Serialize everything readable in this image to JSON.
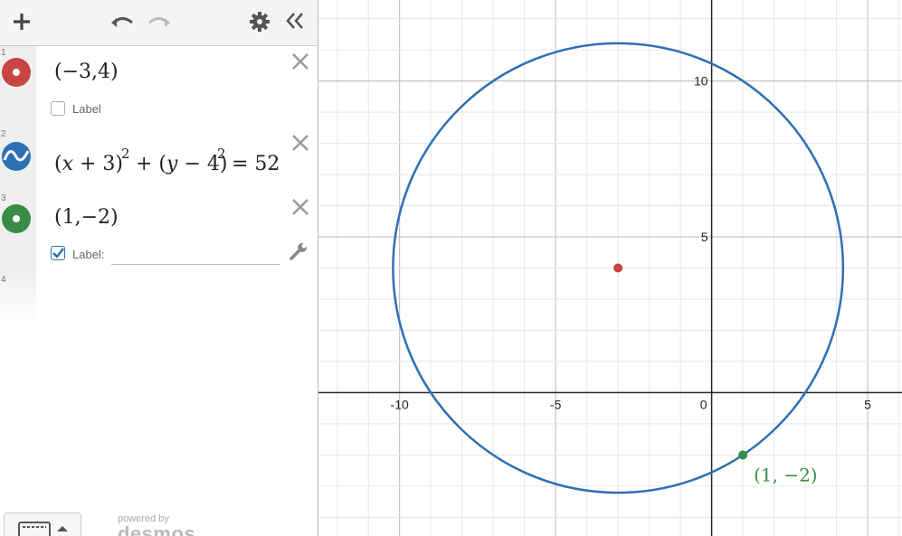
{
  "toolbar": {
    "add_icon": "plus-icon",
    "undo_icon": "undo-icon",
    "redo_icon": "redo-icon",
    "settings_icon": "gear-icon",
    "collapse_icon": "double-chevron-left-icon"
  },
  "expressions": [
    {
      "number": "1",
      "latex": "(−3,4)",
      "color": "#c74440",
      "type": "point",
      "label_text": "Label",
      "label_checked": false
    },
    {
      "number": "2",
      "latex": "(x+3)^2+(y−4)^2=52",
      "color": "#2d70b3",
      "type": "curve"
    },
    {
      "number": "3",
      "latex": "(1,−2)",
      "color": "#388c46",
      "type": "point",
      "label_text": "Label:",
      "label_checked": true,
      "label_value": ""
    },
    {
      "number": "4",
      "latex": ""
    }
  ],
  "graph": {
    "x_range": [
      -12.6,
      6.1
    ],
    "y_range": [
      -4.6,
      12.6
    ],
    "x_ticks": [
      "-10",
      "-5",
      "0",
      "5"
    ],
    "y_ticks": [
      "5",
      "10"
    ],
    "grid": true,
    "circle": {
      "center": [
        -3,
        4
      ],
      "radius_squared": 52,
      "color": "#2d70b3"
    },
    "points": [
      {
        "x": -3,
        "y": 4,
        "color": "#c74440",
        "label": ""
      },
      {
        "x": 1,
        "y": -2,
        "color": "#388c46",
        "label": "(1, −2)"
      }
    ]
  },
  "footer": {
    "powered_by": "powered by",
    "brand": "desmos",
    "keyboard_icon": "keyboard-icon"
  }
}
